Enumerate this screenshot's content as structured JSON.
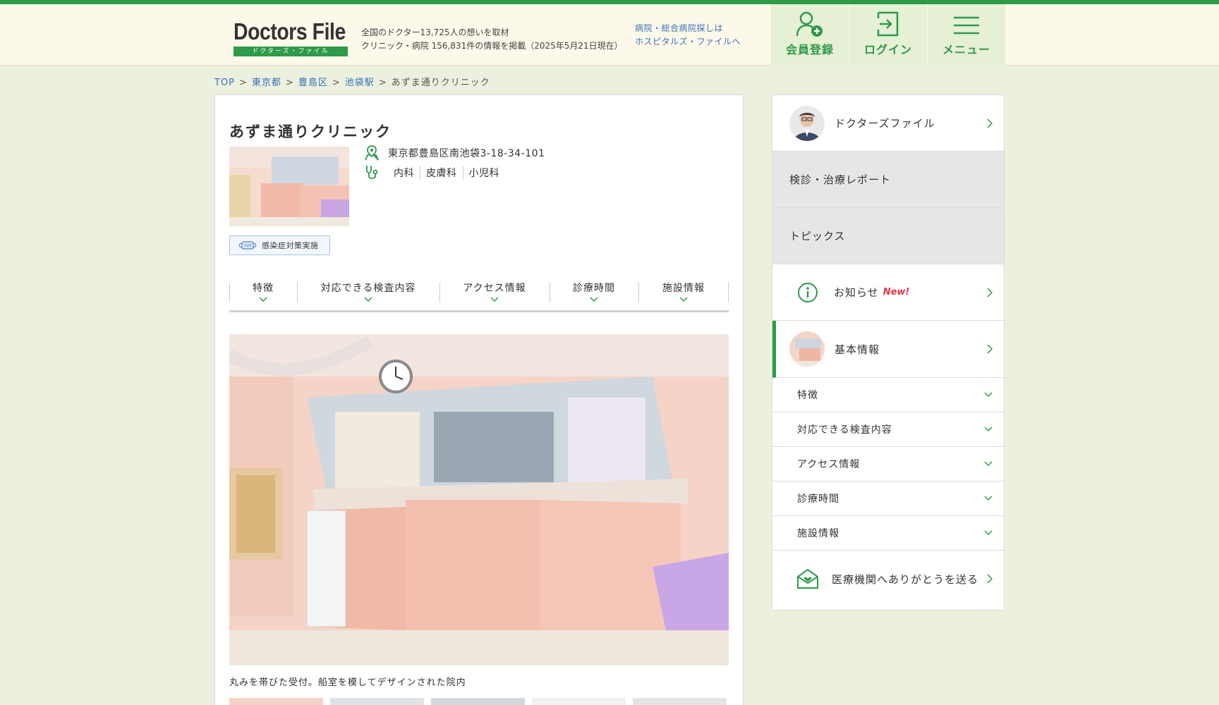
{
  "header": {
    "logo_text": "Doctors File",
    "logo_sub": "ドクターズ・ファイル",
    "tagline_line1": "全国のドクター13,725人の想いを取材",
    "tagline_line2": "クリニック・病院 156,831件の情報を掲載（2025年5月21日現在）",
    "hospital_link_line1": "病院・総合病院探しは",
    "hospital_link_line2": "ホスピタルズ・ファイルへ",
    "buttons": {
      "register": "会員登録",
      "login": "ログイン",
      "menu": "メニュー"
    },
    "accent_color": "#2e9a4a"
  },
  "breadcrumb": {
    "items": [
      "TOP",
      "東京都",
      "豊島区",
      "池袋駅"
    ],
    "current": "あずま通りクリニック",
    "separator": ">"
  },
  "clinic": {
    "name": "あずま通りクリニック",
    "address": "東京都豊島区南池袋3-18-34-101",
    "departments": [
      "内科",
      "皮膚科",
      "小児科"
    ],
    "badge": "感染症対策実施",
    "caption": "丸みを帯びた受付。船室を模してデザインされた院内"
  },
  "tabs": [
    "特徴",
    "対応できる検査内容",
    "アクセス情報",
    "診療時間",
    "施設情報"
  ],
  "side_nav": {
    "doctors_file": "ドクターズファイル",
    "report": "検診・治療レポート",
    "topics": "トピックス",
    "news": "お知らせ",
    "news_badge": "New!",
    "basic_info": "基本情報",
    "sub_items": [
      "特徴",
      "対応できる検査内容",
      "アクセス情報",
      "診療時間",
      "施設情報"
    ],
    "thanks": "医療機関へありがとうを送る"
  }
}
